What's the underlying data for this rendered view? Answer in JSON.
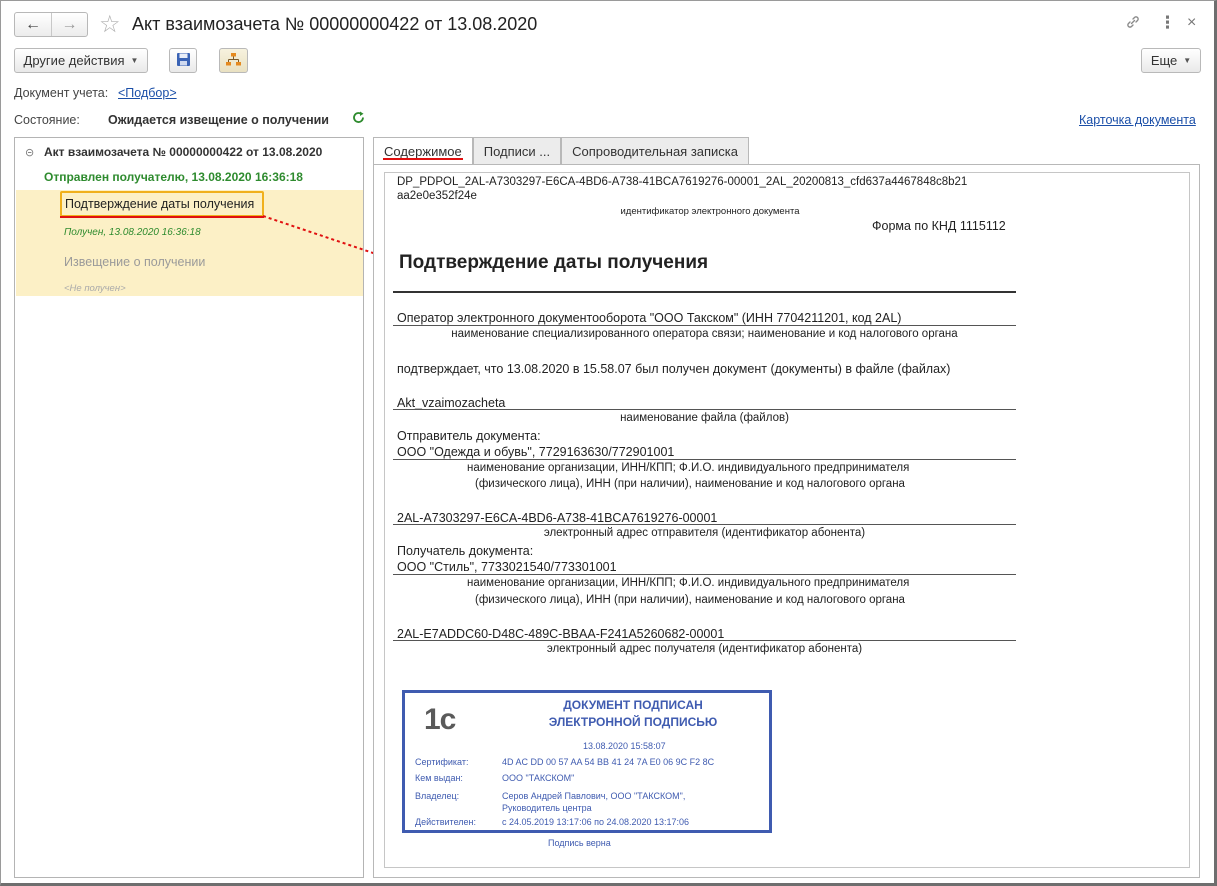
{
  "window": {
    "title": "Акт взаимозачета № 00000000422 от 13.08.2020"
  },
  "toolbar": {
    "other_actions_label": "Другие действия",
    "more_label": "Еще"
  },
  "fields": {
    "doc_account_label": "Документ учета:",
    "doc_account_value": "<Подбор>",
    "status_label": "Состояние:",
    "status_value": "Ожидается извещение о получении",
    "doc_card_link": "Карточка документа"
  },
  "tree": {
    "root": "Акт взаимозачета № 00000000422 от 13.08.2020",
    "sent": "Отправлен получателю, 13.08.2020 16:36:18",
    "confirm": "Подтверждение даты получения",
    "confirm_status": "Получен, 13.08.2020 16:36:18",
    "notice": "Извещение о получении",
    "notice_status": "<Не получен>"
  },
  "tabs": [
    "Содержимое",
    "Подписи ...",
    "Сопроводительная записка"
  ],
  "document": {
    "id_line1": "DP_PDPOL_2AL-A7303297-E6CA-4BD6-A738-41BCA7619276-00001_2AL_20200813_cfd637a4467848c8b21",
    "id_line2": "aa2e0e352f24e",
    "id_caption": "идентификатор электронного документа",
    "form": "Форма по КНД 1115112",
    "heading": "Подтверждение даты получения",
    "operator": "Оператор электронного документооборота \"ООО Такском\" (ИНН 7704211201, код 2AL)",
    "operator_caption": "наименование специализированного оператора связи; наименование и код налогового органа",
    "confirms": "подтверждает, что 13.08.2020 в 15.58.07 был получен документ  (документы) в файле (файлах)",
    "file": "Akt_vzaimozacheta",
    "file_caption": "наименование файла (файлов)",
    "sender_label": "Отправитель документа:",
    "sender": "ООО \"Одежда и обувь\", 7729163630/772901001",
    "org_caption1": "наименование организации, ИНН/КПП; Ф.И.О. индивидуального предпринимателя",
    "org_caption2": "(физического лица), ИНН (при наличии), наименование и код налогового органа",
    "sender_address": "2AL-A7303297-E6CA-4BD6-A738-41BCA7619276-00001",
    "sender_address_caption": "электронный адрес отправителя (идентификатор абонента)",
    "recipient_label": "Получатель документа:",
    "recipient": "ООО \"Стиль\", 7733021540/773301001",
    "recipient_address": "2AL-E7ADDC60-D48C-489C-BBAA-F241A5260682-00001",
    "recipient_address_caption": "электронный адрес получателя (идентификатор абонента)"
  },
  "stamp": {
    "logo": "1с",
    "title1": "ДОКУМЕНТ ПОДПИСАН",
    "title2": "ЭЛЕКТРОННОЙ ПОДПИСЬЮ",
    "datetime": "13.08.2020 15:58:07",
    "cert_label": "Сертификат:",
    "cert_value": "4D AC DD 00 57 AA 54 BB 41 24 7A E0 06 9C F2 8C",
    "issued_label": "Кем выдан:",
    "issued_value": "ООО \"ТАКСКОМ\"",
    "owner_label": "Владелец:",
    "owner_value1": "Серов Андрей Павлович, ООО \"ТАКСКОМ\",",
    "owner_value2": "Руководитель центра",
    "valid_label": "Действителен:",
    "valid_value": "с 24.05.2019 13:17:06 по 24.08.2020 13:17:06",
    "verified": "Подпись верна"
  },
  "colors": {
    "accent_green": "#2e8b2e",
    "link_blue": "#1b4fa8",
    "stamp_blue": "#3f5bb0",
    "highlight": "#fcf0c6",
    "annotation_red": "#e01010"
  }
}
